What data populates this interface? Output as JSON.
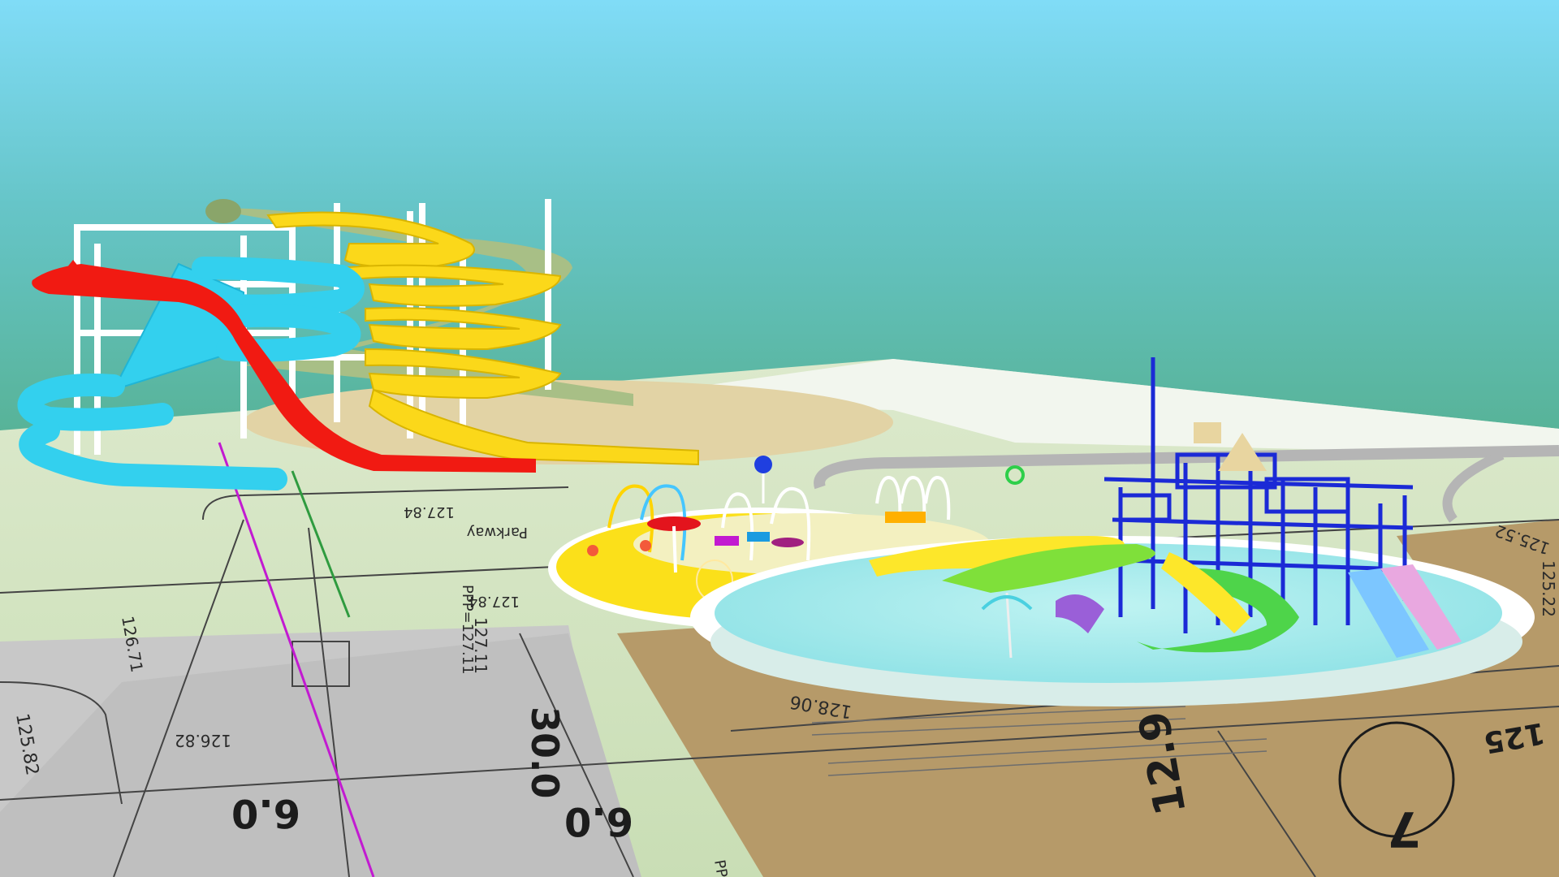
{
  "site_plan": {
    "labels": {
      "l1": "127.84",
      "l2": "127.84",
      "l3": "128.06",
      "l4": "127.11",
      "l5": "126.82",
      "l6": "126.71",
      "l7": "125.82",
      "l8": "125",
      "l9": "125.22",
      "l10": "30.0",
      "l11": "6.0",
      "l12": "6.0",
      "l13": "12.9",
      "l14": "PPP=127.11",
      "l15": "PPP=",
      "l16": "7",
      "l17": "Parkway",
      "l18": "125.52"
    }
  },
  "colors": {
    "sky_top": "#7fdcf6",
    "sky_bottom": "#55b49a",
    "ground_green": "#d6e8c4",
    "ground_gray": "#c7c7c7",
    "ground_brown": "#b79b6a",
    "splash_yellow": "#fbe01a",
    "pool_water": "#a7ecee",
    "slide_red": "#f11a12",
    "slide_cyan": "#33d0ee",
    "slide_yellow": "#fbd81a",
    "slide_sage": "#a8bf86",
    "tower_blue": "#1b2ad6"
  }
}
